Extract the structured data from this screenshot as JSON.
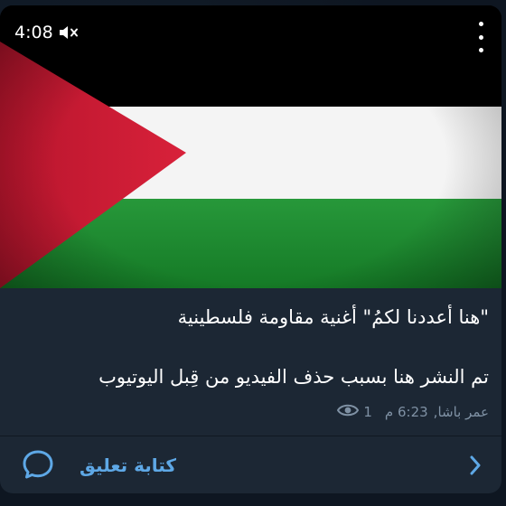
{
  "video": {
    "duration": "4:08",
    "mute_icon": "speaker-muted-icon",
    "menu_icon": "more-vertical-icon",
    "thumbnail": "palestine-flag",
    "colors": {
      "black": "#000000",
      "white": "#ffffff",
      "green": "#1c8a2c",
      "red": "#d11d36"
    }
  },
  "post": {
    "caption_line1": "\"هنا أعددنا لكمُ\" أغنية مقاومة فلسطينية",
    "caption_line2": "تم النشر هنا بسبب حذف الفيديو من قِبل اليوتيوب",
    "author": "عمر باشا,",
    "time": "6:23 م",
    "views": "1",
    "views_icon": "eye-icon"
  },
  "footer": {
    "comment_label": "كتابة تعليق",
    "comment_icon": "comment-bubble-icon",
    "chevron_icon": "chevron-right-icon",
    "accent": "#5ea8e6"
  }
}
